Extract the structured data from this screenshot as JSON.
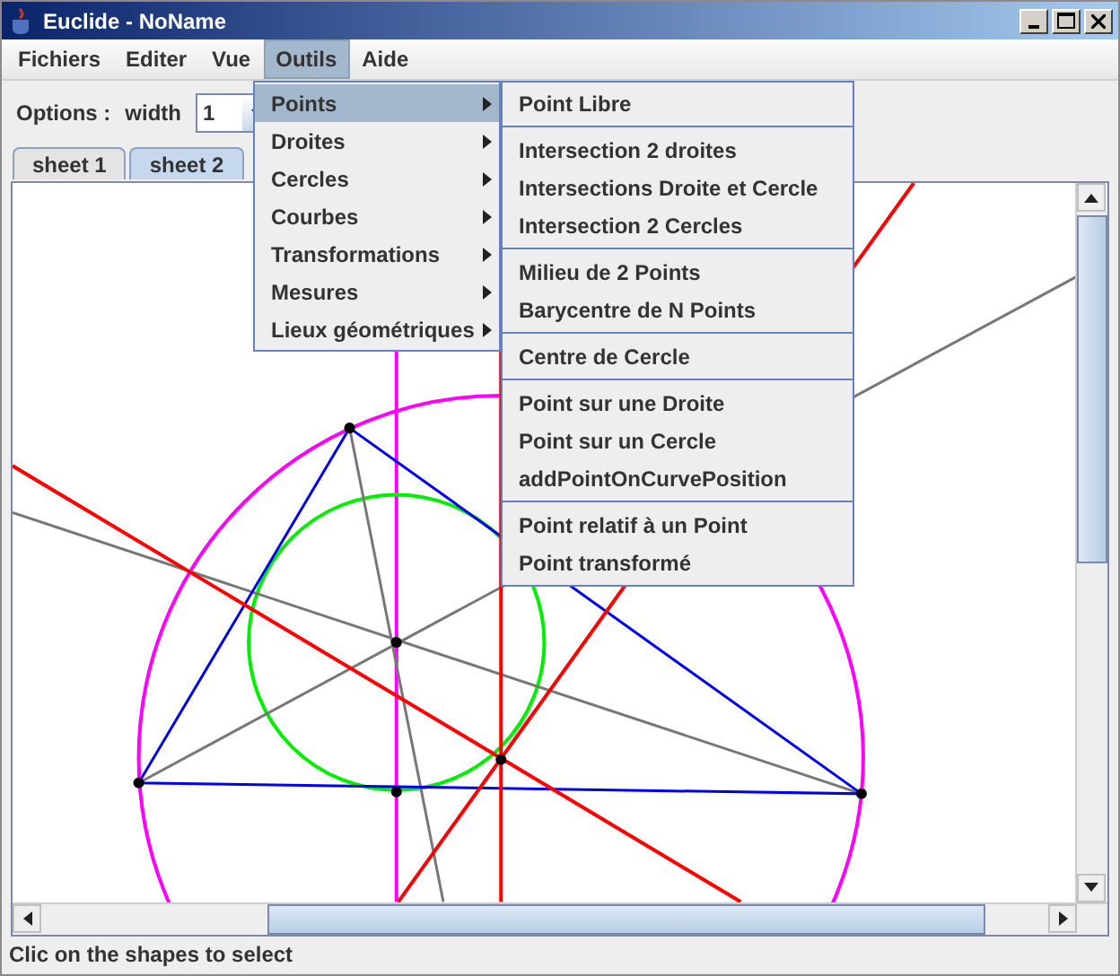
{
  "window": {
    "title": "Euclide - NoName"
  },
  "menubar": [
    {
      "label": "Fichiers",
      "selected": false
    },
    {
      "label": "Editer",
      "selected": false
    },
    {
      "label": "Vue",
      "selected": false
    },
    {
      "label": "Outils",
      "selected": true
    },
    {
      "label": "Aide",
      "selected": false
    }
  ],
  "options": {
    "label": "Options :",
    "width_label": "width",
    "width_value": "1"
  },
  "tabs": [
    {
      "label": "sheet 1",
      "selected": false
    },
    {
      "label": "sheet 2",
      "selected": true
    }
  ],
  "menu": [
    {
      "label": "Points",
      "selected": true
    },
    {
      "label": "Droites",
      "selected": false
    },
    {
      "label": "Cercles",
      "selected": false
    },
    {
      "label": "Courbes",
      "selected": false
    },
    {
      "label": "Transformations",
      "selected": false
    },
    {
      "label": "Mesures",
      "selected": false
    },
    {
      "label": "Lieux géométriques",
      "selected": false
    }
  ],
  "submenu": [
    [
      "Point Libre"
    ],
    [
      "Intersection 2 droites",
      "Intersections Droite et Cercle",
      "Intersection 2 Cercles"
    ],
    [
      "Milieu de 2 Points",
      "Barycentre de N Points"
    ],
    [
      "Centre de Cercle"
    ],
    [
      "Point sur une Droite",
      "Point sur un Cercle",
      "addPointOnCurvePosition"
    ],
    [
      "Point relatif à un Point",
      "Point transformé"
    ]
  ],
  "status_bar": "Clic on the shapes to select"
}
